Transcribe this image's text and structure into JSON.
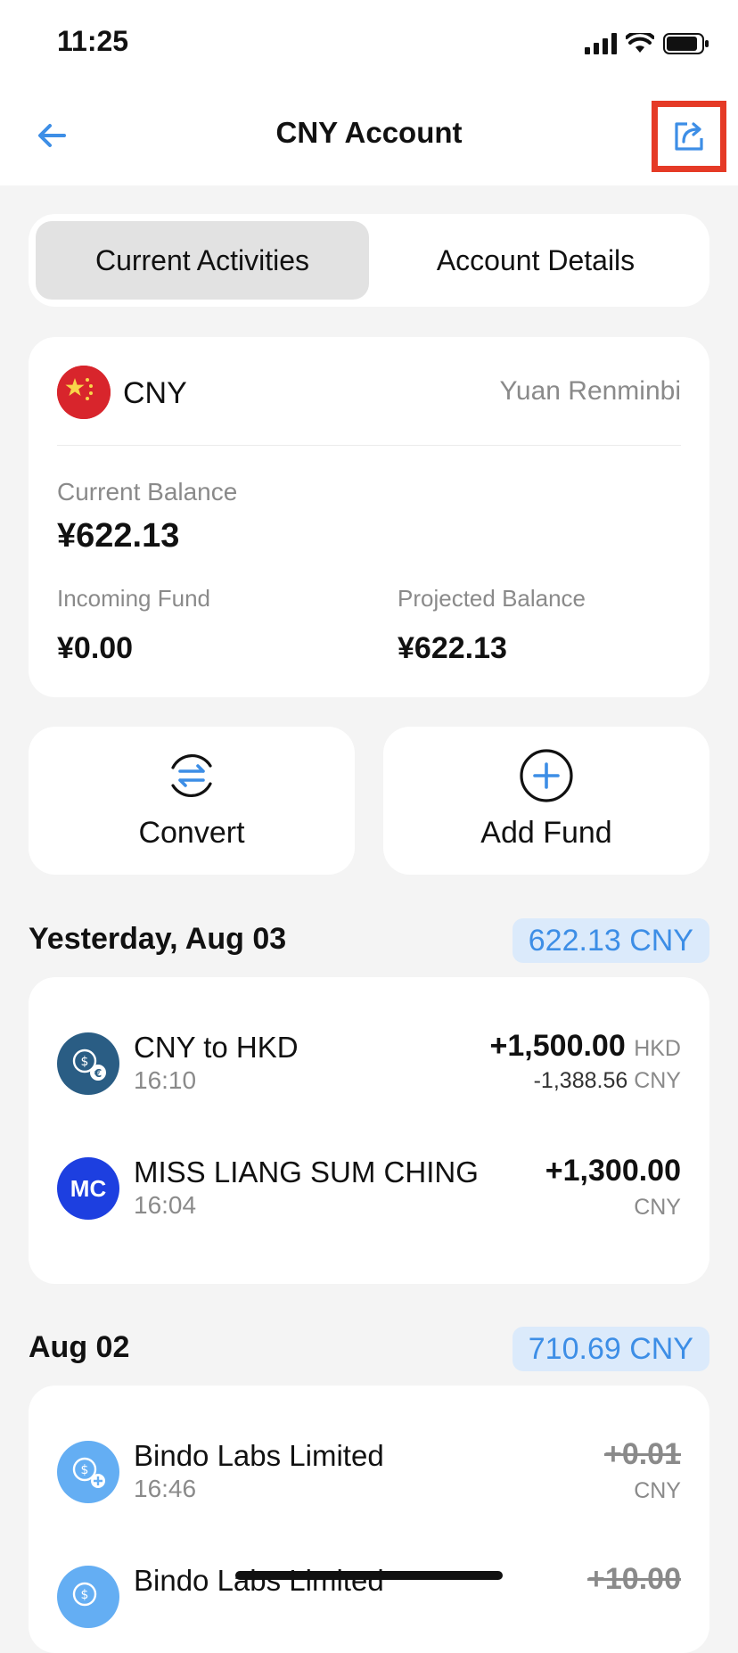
{
  "status_bar": {
    "time": "11:25"
  },
  "nav": {
    "title": "CNY Account"
  },
  "tabs": [
    {
      "label": "Current Activities",
      "active": true
    },
    {
      "label": "Account Details",
      "active": false
    }
  ],
  "account": {
    "code": "CNY",
    "name": "Yuan Renminbi",
    "current_balance_label": "Current Balance",
    "current_balance": "¥622.13",
    "incoming_label": "Incoming Fund",
    "incoming": "¥0.00",
    "projected_label": "Projected Balance",
    "projected": "¥622.13"
  },
  "actions": {
    "convert": "Convert",
    "add_fund": "Add Fund"
  },
  "sections": [
    {
      "date": "Yesterday, Aug 03",
      "total": "622.13 CNY",
      "transactions": [
        {
          "name": "CNY to HKD",
          "time": "16:10",
          "amount": "+1,500.00",
          "amount_unit": "HKD",
          "sub_amount": "-1,388.56",
          "sub_unit": "CNY"
        },
        {
          "name": "MISS LIANG SUM CHING",
          "time": "16:04",
          "avatar": "MC",
          "amount": "+1,300.00",
          "unit": "CNY"
        }
      ]
    },
    {
      "date": "Aug 02",
      "total": "710.69 CNY",
      "transactions": [
        {
          "name": "Bindo Labs Limited",
          "time": "16:46",
          "amount": "+0.01",
          "unit": "CNY"
        },
        {
          "name": "Bindo Labs Limited",
          "amount": "+10.00"
        }
      ]
    }
  ],
  "colors": {
    "accent": "#3d8ee6",
    "share_highlight": "#e53a26",
    "pill_bg": "#dbeafb"
  },
  "icons": [
    "back-arrow-icon",
    "share-icon",
    "china-flag-icon",
    "convert-icon",
    "add-circle-icon",
    "exchange-icon",
    "deposit-icon"
  ]
}
